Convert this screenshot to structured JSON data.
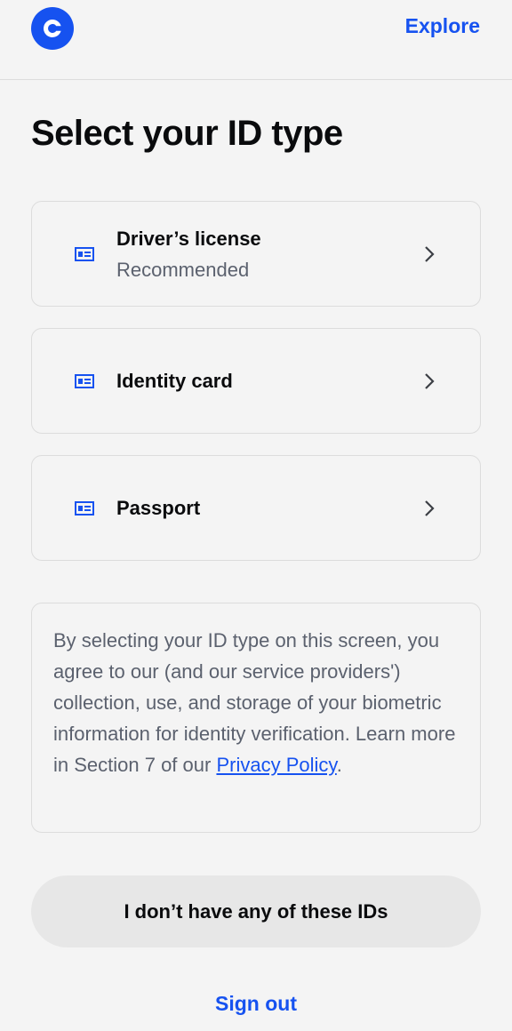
{
  "header": {
    "logo_icon": "coinbase-logo-icon",
    "explore_label": "Explore",
    "accent_color": "#1652f0"
  },
  "page": {
    "title": "Select your ID type"
  },
  "options": [
    {
      "title": "Driver’s license",
      "subtitle": "Recommended",
      "icon": "id-card-icon",
      "chevron": "chevron-right-icon"
    },
    {
      "title": "Identity card",
      "icon": "id-card-icon",
      "chevron": "chevron-right-icon"
    },
    {
      "title": "Passport",
      "icon": "id-card-icon",
      "chevron": "chevron-right-icon"
    }
  ],
  "consent": {
    "text_before_link": "By selecting your ID type on this screen, you agree to our (and our service providers') collection, use, and storage of your biometric information for identity verification. Learn more in Section 7 of our ",
    "link_label": "Privacy Policy",
    "text_after_link": "."
  },
  "actions": {
    "no_id_label": "I don’t have any of these IDs",
    "sign_out_label": "Sign out"
  }
}
